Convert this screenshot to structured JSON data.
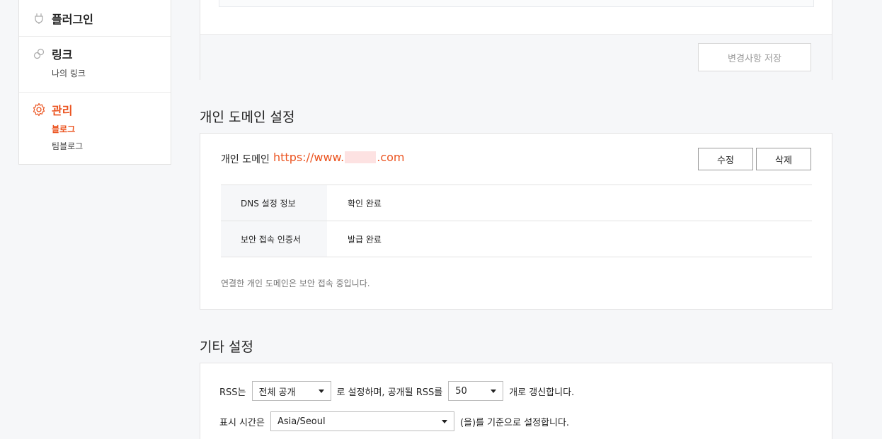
{
  "sidebar": {
    "plugin": {
      "label": "플러그인",
      "icon": "plug-icon"
    },
    "link": {
      "label": "링크",
      "icon": "link-icon",
      "items": [
        "나의 링크"
      ]
    },
    "manage": {
      "label": "관리",
      "icon": "gear-icon",
      "items": [
        "블로그",
        "팀블로그"
      ]
    }
  },
  "save_section": {
    "save_label": "변경사항 저장"
  },
  "domain": {
    "title": "개인 도메인 설정",
    "label": "개인 도메인",
    "url_prefix": "https://www.",
    "url_suffix": ".com",
    "edit_label": "수정",
    "delete_label": "삭제",
    "rows": [
      {
        "key": "DNS 설정 정보",
        "value": "확인 완료"
      },
      {
        "key": "보안 접속 인증서",
        "value": "발급 완료"
      }
    ],
    "note": "연결한 개인 도메인은 보안 접속 중입니다."
  },
  "etc": {
    "title": "기타 설정",
    "rss_prefix": "RSS는",
    "rss_scope": "전체 공개",
    "rss_middle": "로 설정하며, 공개될 RSS를",
    "rss_count": "50",
    "rss_suffix": "개로 갱신합니다.",
    "time_prefix": "표시 시간은",
    "timezone": "Asia/Seoul",
    "time_suffix": "(을)를 기준으로 설정합니다."
  },
  "colors": {
    "accent": "#eb531f"
  }
}
